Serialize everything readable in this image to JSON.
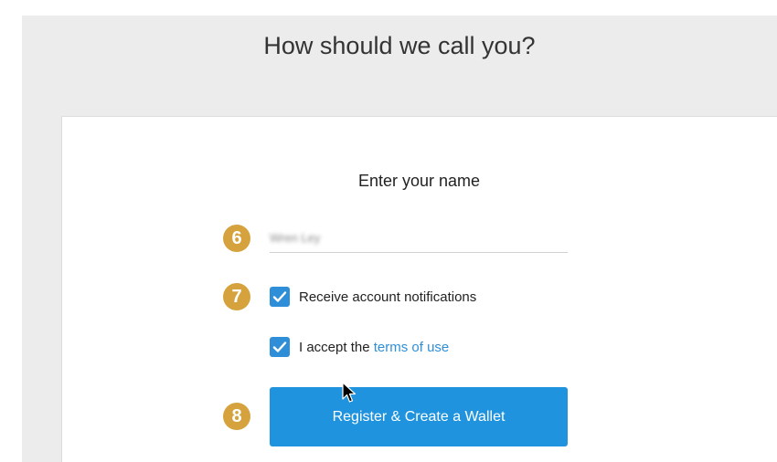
{
  "page": {
    "title": "How should we call you?"
  },
  "form": {
    "heading": "Enter your name",
    "name_value_blurred": "Wren Ley",
    "checkbox_notifications_label": "Receive account notifications",
    "checkbox_notifications_checked": true,
    "checkbox_terms_prefix": "I accept the ",
    "checkbox_terms_link": "terms of use",
    "checkbox_terms_checked": true,
    "submit_label": "Register & Create a Wallet"
  },
  "steps": {
    "name_step": "6",
    "notifications_step": "7",
    "submit_step": "8"
  },
  "colors": {
    "background": "#ececec",
    "card": "#ffffff",
    "accent_blue": "#1f93de",
    "badge_gold": "#d6a23e",
    "link_blue": "#2f8fd8"
  },
  "icons": {
    "checkbox": "check-icon",
    "pointer": "mouse-pointer-icon"
  }
}
